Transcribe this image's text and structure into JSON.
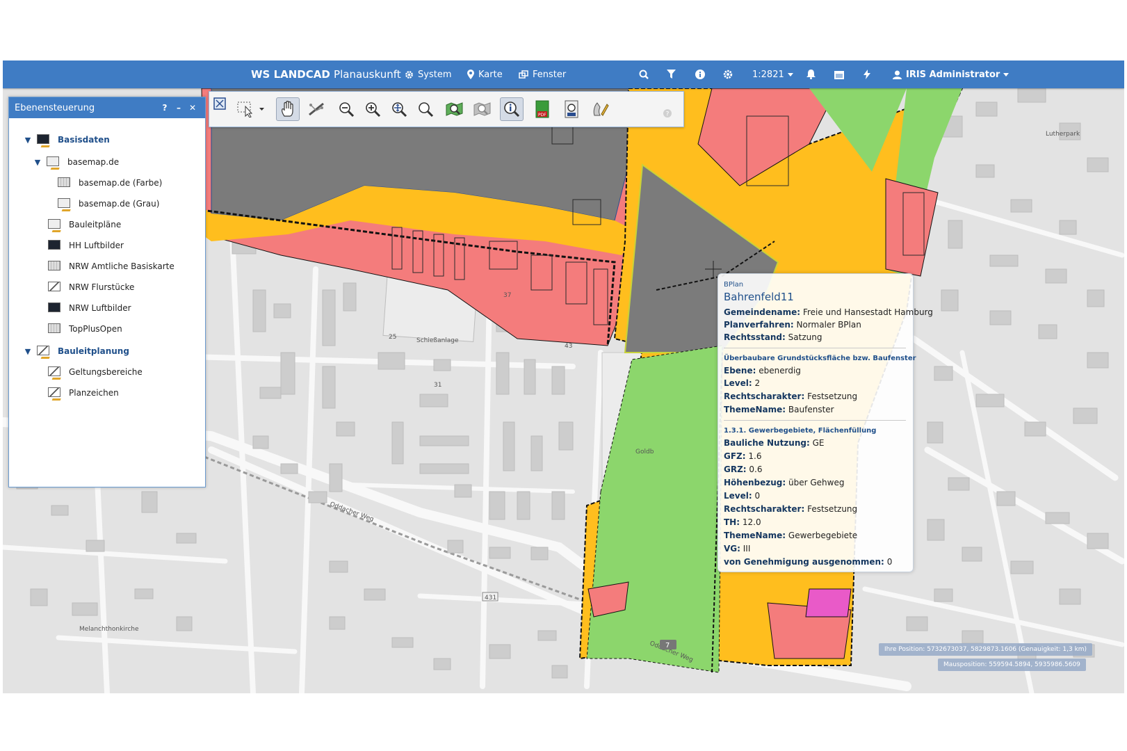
{
  "app": {
    "brand_bold": "WS LANDCAD",
    "brand_light": "Planauskunft",
    "menu": [
      {
        "label": "System",
        "icon": "gear-icon"
      },
      {
        "label": "Karte",
        "icon": "map-marker-icon"
      },
      {
        "label": "Fenster",
        "icon": "windows-icon"
      }
    ],
    "scale": "1:2821",
    "user": "IRIS Administrator"
  },
  "layer_panel": {
    "title": "Ebenensteuerung",
    "items": [
      {
        "label": "Basisdaten"
      },
      {
        "label": "basemap.de"
      },
      {
        "label": "basemap.de (Farbe)"
      },
      {
        "label": "basemap.de (Grau)"
      },
      {
        "label": "Bauleitpläne"
      },
      {
        "label": "HH Luftbilder"
      },
      {
        "label": "NRW Amtliche Basiskarte"
      },
      {
        "label": "NRW Flurstücke"
      },
      {
        "label": "NRW Luftbilder"
      },
      {
        "label": "TopPlusOpen"
      },
      {
        "label": "Bauleitplanung"
      },
      {
        "label": "Geltungsbereiche"
      },
      {
        "label": "Planzeichen"
      }
    ]
  },
  "popup": {
    "type": "BPlan",
    "name": "Bahrenfeld11",
    "rows": [
      {
        "key": "Gemeindename:",
        "value": "Freie und Hansestadt Hamburg"
      },
      {
        "key": "Planverfahren:",
        "value": "Normaler BPlan"
      },
      {
        "key": "Rechtsstand:",
        "value": "Satzung"
      }
    ],
    "section1": "Überbaubare Grundstücksfläche bzw. Baufenster",
    "rows1": [
      {
        "key": "Ebene:",
        "value": "ebenerdig"
      },
      {
        "key": "Level:",
        "value": "2"
      },
      {
        "key": "Rechtscharakter:",
        "value": "Festsetzung"
      },
      {
        "key": "ThemeName:",
        "value": "Baufenster"
      }
    ],
    "section2": "1.3.1. Gewerbegebiete, Flächenfüllung",
    "rows2": [
      {
        "key": "Bauliche Nutzung:",
        "value": "GE"
      },
      {
        "key": "GFZ:",
        "value": "1.6"
      },
      {
        "key": "GRZ:",
        "value": "0.6"
      },
      {
        "key": "Höhenbezug:",
        "value": "über Gehweg"
      },
      {
        "key": "Level:",
        "value": "0"
      },
      {
        "key": "Rechtscharakter:",
        "value": "Festsetzung"
      },
      {
        "key": "TH:",
        "value": "12.0"
      },
      {
        "key": "ThemeName:",
        "value": "Gewerbegebiete"
      },
      {
        "key": "VG:",
        "value": "III"
      },
      {
        "key": "von Genehmigung ausgenommen:",
        "value": "0"
      }
    ]
  },
  "status": {
    "your_position": "Ihre Position: 5732673037, 5829873.1606 (Genauigkeit: 1,3 km)",
    "mouse_position": "Mausposition: 559594.5894, 5935986.5609"
  },
  "map_labels": {
    "school": "Schießanlage",
    "street1": "Oddacher Weg",
    "street2": "Oddacher Weg",
    "church": "Melanchthonkirche",
    "road_number": "431",
    "b7": "7",
    "goldbek": "Goldb",
    "lutherpark": "Lutherpark",
    "house_no_1": "31",
    "house_no_2": "25",
    "house_no_3": "37",
    "house_no_4": "43"
  },
  "colors": {
    "topbar": "#3f7cc4",
    "industrial": "#f47c7c",
    "mixed": "#ffbe1e",
    "green": "#8cd66c",
    "grey_block": "#7b7b7b",
    "pink": "#e95ac8"
  }
}
